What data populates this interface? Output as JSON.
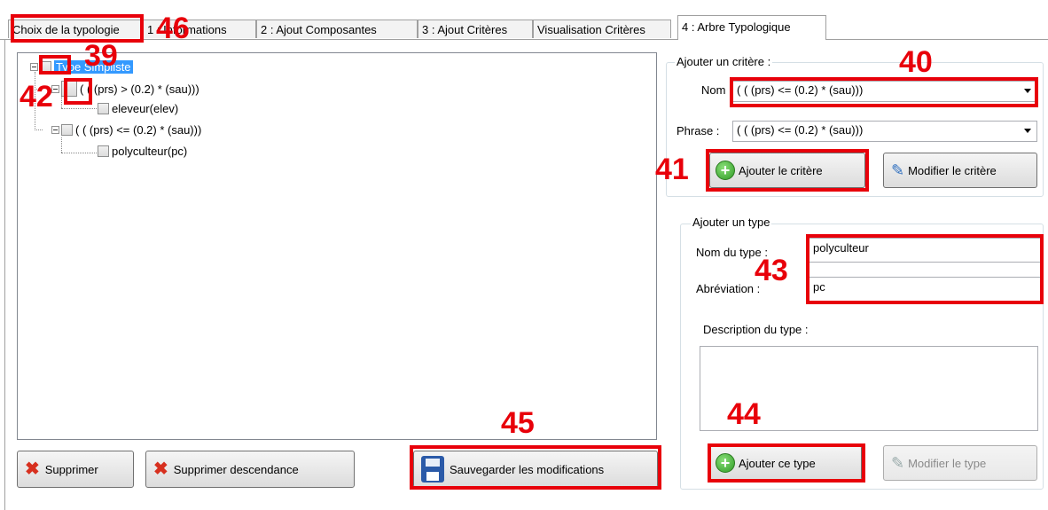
{
  "tabs": [
    {
      "label": "Choix de la typologie"
    },
    {
      "label": "1 : Informations"
    },
    {
      "label": "2 : Ajout Composantes"
    },
    {
      "label": "3 : Ajout Critères"
    },
    {
      "label": "Visualisation Critères"
    },
    {
      "label": "4 : Arbre Typologique"
    }
  ],
  "tree": {
    "root": "Type Simpliste",
    "nodes": [
      {
        "label": "( (  (prs) >   (0.2) * (sau)))"
      },
      {
        "label": "eleveur(elev)"
      },
      {
        "label": "( (  (prs) <=   (0.2) * (sau)))"
      },
      {
        "label": "polyculteur(pc)"
      }
    ]
  },
  "buttons": {
    "delete": "Supprimer",
    "delete_descendants": "Supprimer descendance",
    "save": "Sauvegarder les modifications",
    "add_criterion": "Ajouter le critère",
    "edit_criterion": "Modifier le critère",
    "add_type": "Ajouter ce type",
    "edit_type": "Modifier le type"
  },
  "criterion_group": {
    "legend": "Ajouter un critère :",
    "name_label": "Nom :",
    "name_value": "( (  (prs) <=   (0.2) * (sau)))",
    "phrase_label": "Phrase :",
    "phrase_value": "( (  (prs) <=   (0.2) * (sau)))"
  },
  "type_group": {
    "legend": "Ajouter un type",
    "name_label": "Nom du type :",
    "name_value": "polyculteur",
    "abbr_label": "Abréviation :",
    "abbr_value": "pc",
    "desc_label": "Description du type :",
    "desc_value": ""
  },
  "annotations": [
    "46",
    "39",
    "42",
    "40",
    "41",
    "43",
    "44",
    "45"
  ],
  "colors": {
    "annotation": "#e8000a",
    "selection": "#3399ff"
  }
}
